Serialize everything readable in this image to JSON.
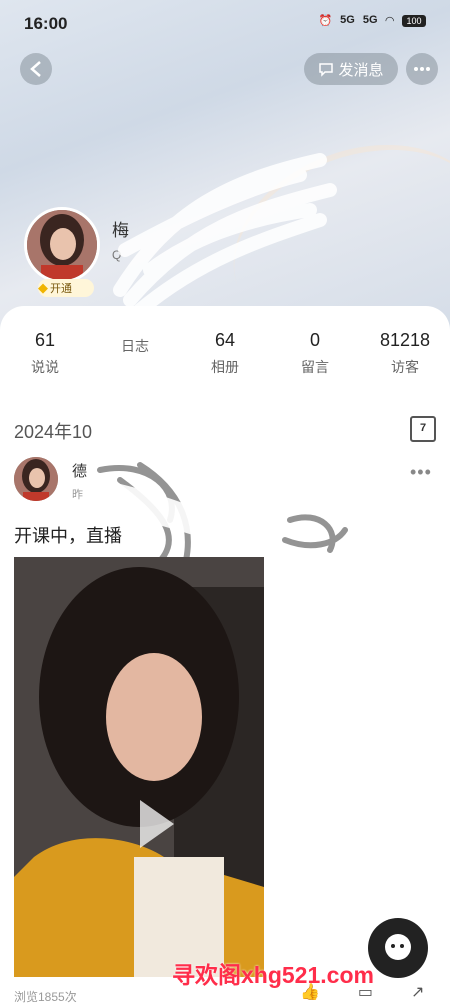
{
  "status_bar": {
    "time": "16:00",
    "net1": "5G",
    "net2": "5G",
    "battery": "100"
  },
  "header": {
    "send_message_label": "发消息"
  },
  "profile": {
    "name": "梅",
    "qq": "Q",
    "vip_label": "开通"
  },
  "stats": [
    {
      "number": "61",
      "label": "说说"
    },
    {
      "number": "",
      "label": "日志"
    },
    {
      "number": "64",
      "label": "相册"
    },
    {
      "number": "0",
      "label": "留言"
    },
    {
      "number": "81218",
      "label": "访客"
    }
  ],
  "feed": {
    "date": "2024年10",
    "calendar_day": "7",
    "post": {
      "author": "德",
      "subtitle": "昨",
      "text": "开课中，直播",
      "views": "浏览1855次"
    }
  },
  "watermark": "寻欢阁xhg521.com",
  "colors": {
    "accent": "#ff2d4a",
    "sheet": "#ffffff",
    "header_bg": "#d5dde8"
  }
}
